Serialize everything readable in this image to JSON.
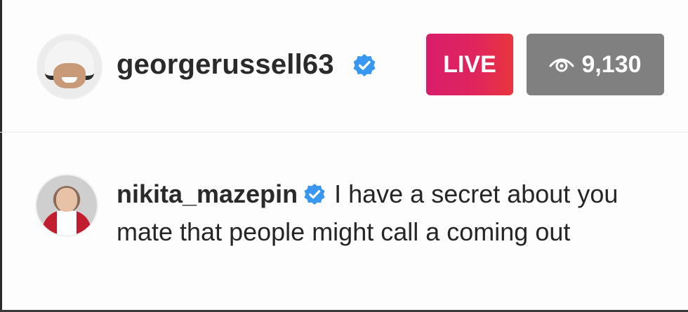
{
  "header": {
    "username": "georgerussell63",
    "verified_icon": "verified-badge-icon",
    "live_label": "LIVE",
    "viewers_count": "9,130",
    "viewers_icon": "eye-icon"
  },
  "comment": {
    "username": "nikita_mazepin",
    "verified_icon": "verified-badge-icon",
    "text": "I have a secret about you mate that people might call a coming out"
  },
  "colors": {
    "live_gradient_start": "#d81e6a",
    "live_gradient_end": "#e8353f",
    "viewers_bg": "#808080",
    "verified_blue": "#3897f0"
  }
}
